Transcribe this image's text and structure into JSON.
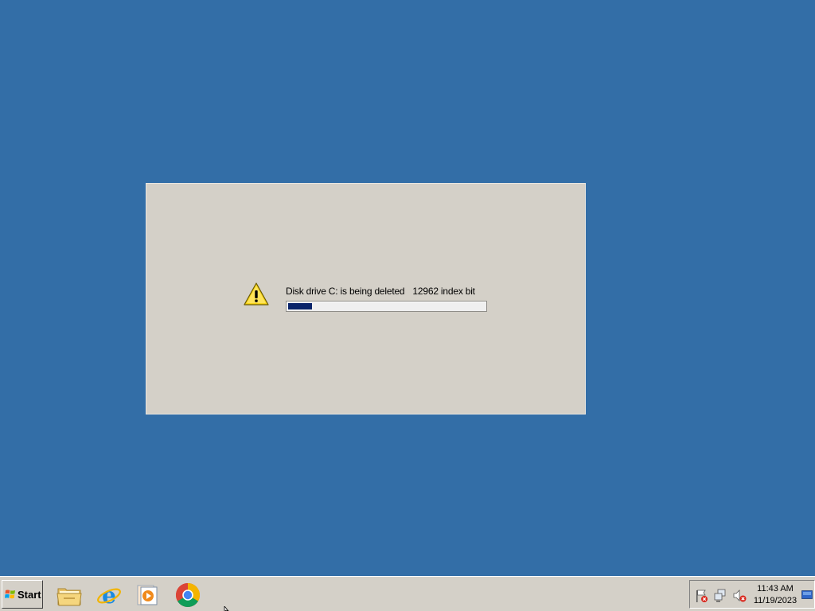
{
  "dialog": {
    "message": "Disk drive C: is being deleted",
    "index_count": "12962 index bit",
    "progress_fraction": 0.12,
    "icon": "warning-icon"
  },
  "taskbar": {
    "start_label": "Start",
    "apps": [
      {
        "name": "file-explorer",
        "icon": "folder-icon"
      },
      {
        "name": "internet-explorer",
        "icon": "ie-icon"
      },
      {
        "name": "media-player",
        "icon": "media-player-icon"
      },
      {
        "name": "chrome",
        "icon": "chrome-icon"
      }
    ],
    "tray": {
      "icons": [
        "action-center-flag-icon",
        "network-icon",
        "volume-muted-icon"
      ],
      "time": "11:43 AM",
      "date": "11/19/2023"
    }
  },
  "colors": {
    "desktop": "#336ea7",
    "dialog_bg": "#d4d0c8",
    "progress_fill": "#0a246a",
    "taskbar": "#d4d0c8"
  }
}
